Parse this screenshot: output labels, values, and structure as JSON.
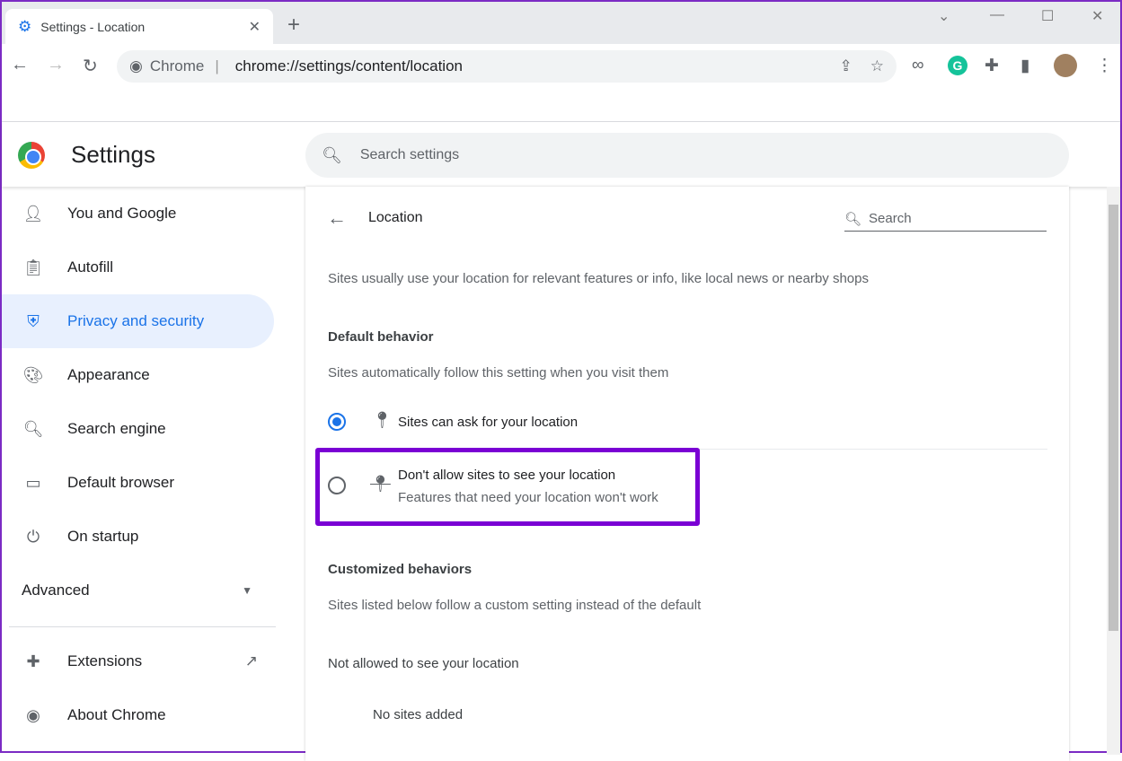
{
  "browser": {
    "tab_title": "Settings - Location",
    "omnibox_site": "Chrome",
    "omnibox_url": "chrome://settings/content/location"
  },
  "header": {
    "title": "Settings",
    "search_placeholder": "Search settings"
  },
  "sidebar": {
    "items": [
      {
        "label": "You and Google",
        "icon": "person-icon"
      },
      {
        "label": "Autofill",
        "icon": "clipboard-icon"
      },
      {
        "label": "Privacy and security",
        "icon": "shield-icon",
        "active": true
      },
      {
        "label": "Appearance",
        "icon": "palette-icon"
      },
      {
        "label": "Search engine",
        "icon": "search-icon"
      },
      {
        "label": "Default browser",
        "icon": "browser-icon"
      },
      {
        "label": "On startup",
        "icon": "power-icon"
      }
    ],
    "advanced": "Advanced",
    "extensions": "Extensions",
    "about": "About Chrome"
  },
  "page": {
    "title": "Location",
    "search_placeholder": "Search",
    "description": "Sites usually use your location for relevant features or info, like local news or nearby shops",
    "default_heading": "Default behavior",
    "default_sub": "Sites automatically follow this setting when you visit them",
    "option_allow": "Sites can ask for your location",
    "option_block": "Don't allow sites to see your location",
    "option_block_sub": "Features that need your location won't work",
    "custom_heading": "Customized behaviors",
    "custom_sub": "Sites listed below follow a custom setting instead of the default",
    "not_allowed": "Not allowed to see your location",
    "no_sites": "No sites added"
  },
  "colors": {
    "accent": "#1a73e8",
    "highlight": "#7a00d4"
  }
}
